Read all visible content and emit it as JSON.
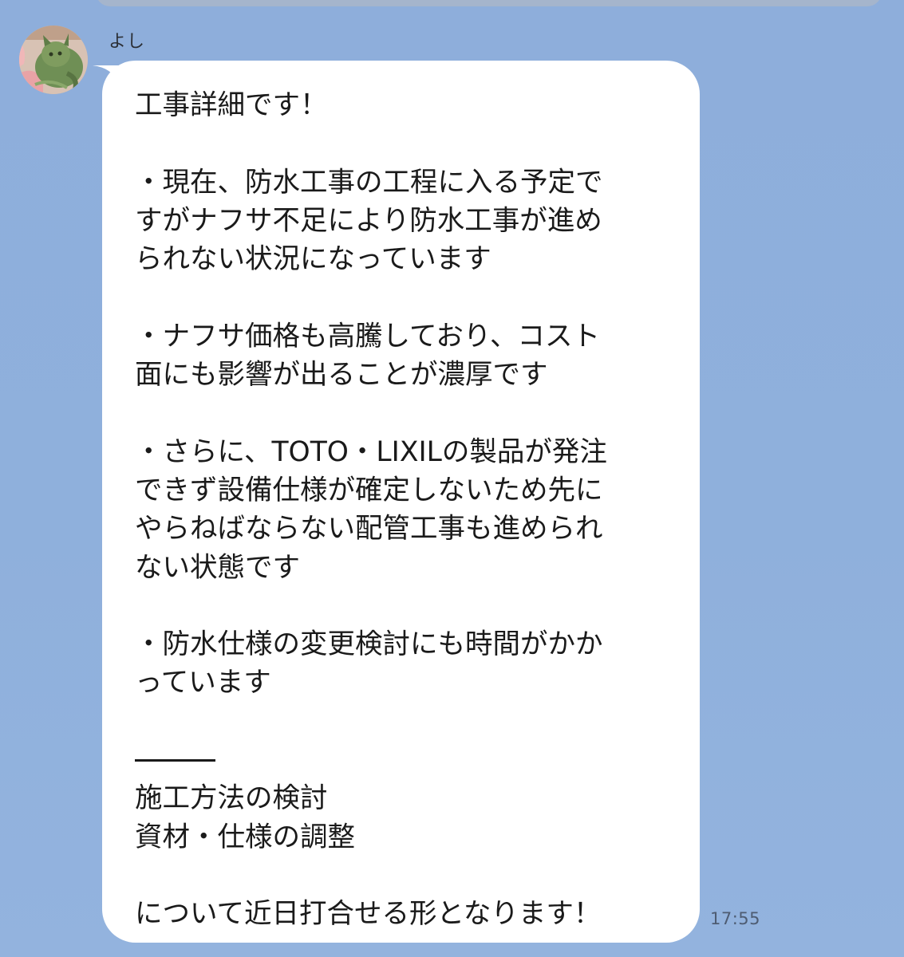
{
  "sender": {
    "name": "よし",
    "avatar": "cat-photo-avatar"
  },
  "message": {
    "lines": [
      "工事詳細です！",
      "",
      "・現在、防水工事の工程に入る予定で",
      "すがナフサ不足により防水工事が進め",
      "られない状況になっています",
      "",
      "・ナフサ価格も高騰しており、コスト",
      "面にも影響が出ることが濃厚です",
      "",
      "・さらに、TOTO・LIXILの製品が発注",
      "できず設備仕様が確定しないため先に",
      "やらねばならない配管工事も進められ",
      "ない状態です",
      "",
      "・防水仕様の変更検討にも時間がかか",
      "っています",
      "",
      "———",
      "施工方法の検討",
      "資材・仕様の調整",
      "",
      "について近日打合せる形となります！"
    ],
    "timestamp": "17:55"
  },
  "colors": {
    "background": "#8fb0dc",
    "bubble": "#ffffff",
    "text": "#1a1a1a",
    "timestamp": "#4e5c72"
  }
}
